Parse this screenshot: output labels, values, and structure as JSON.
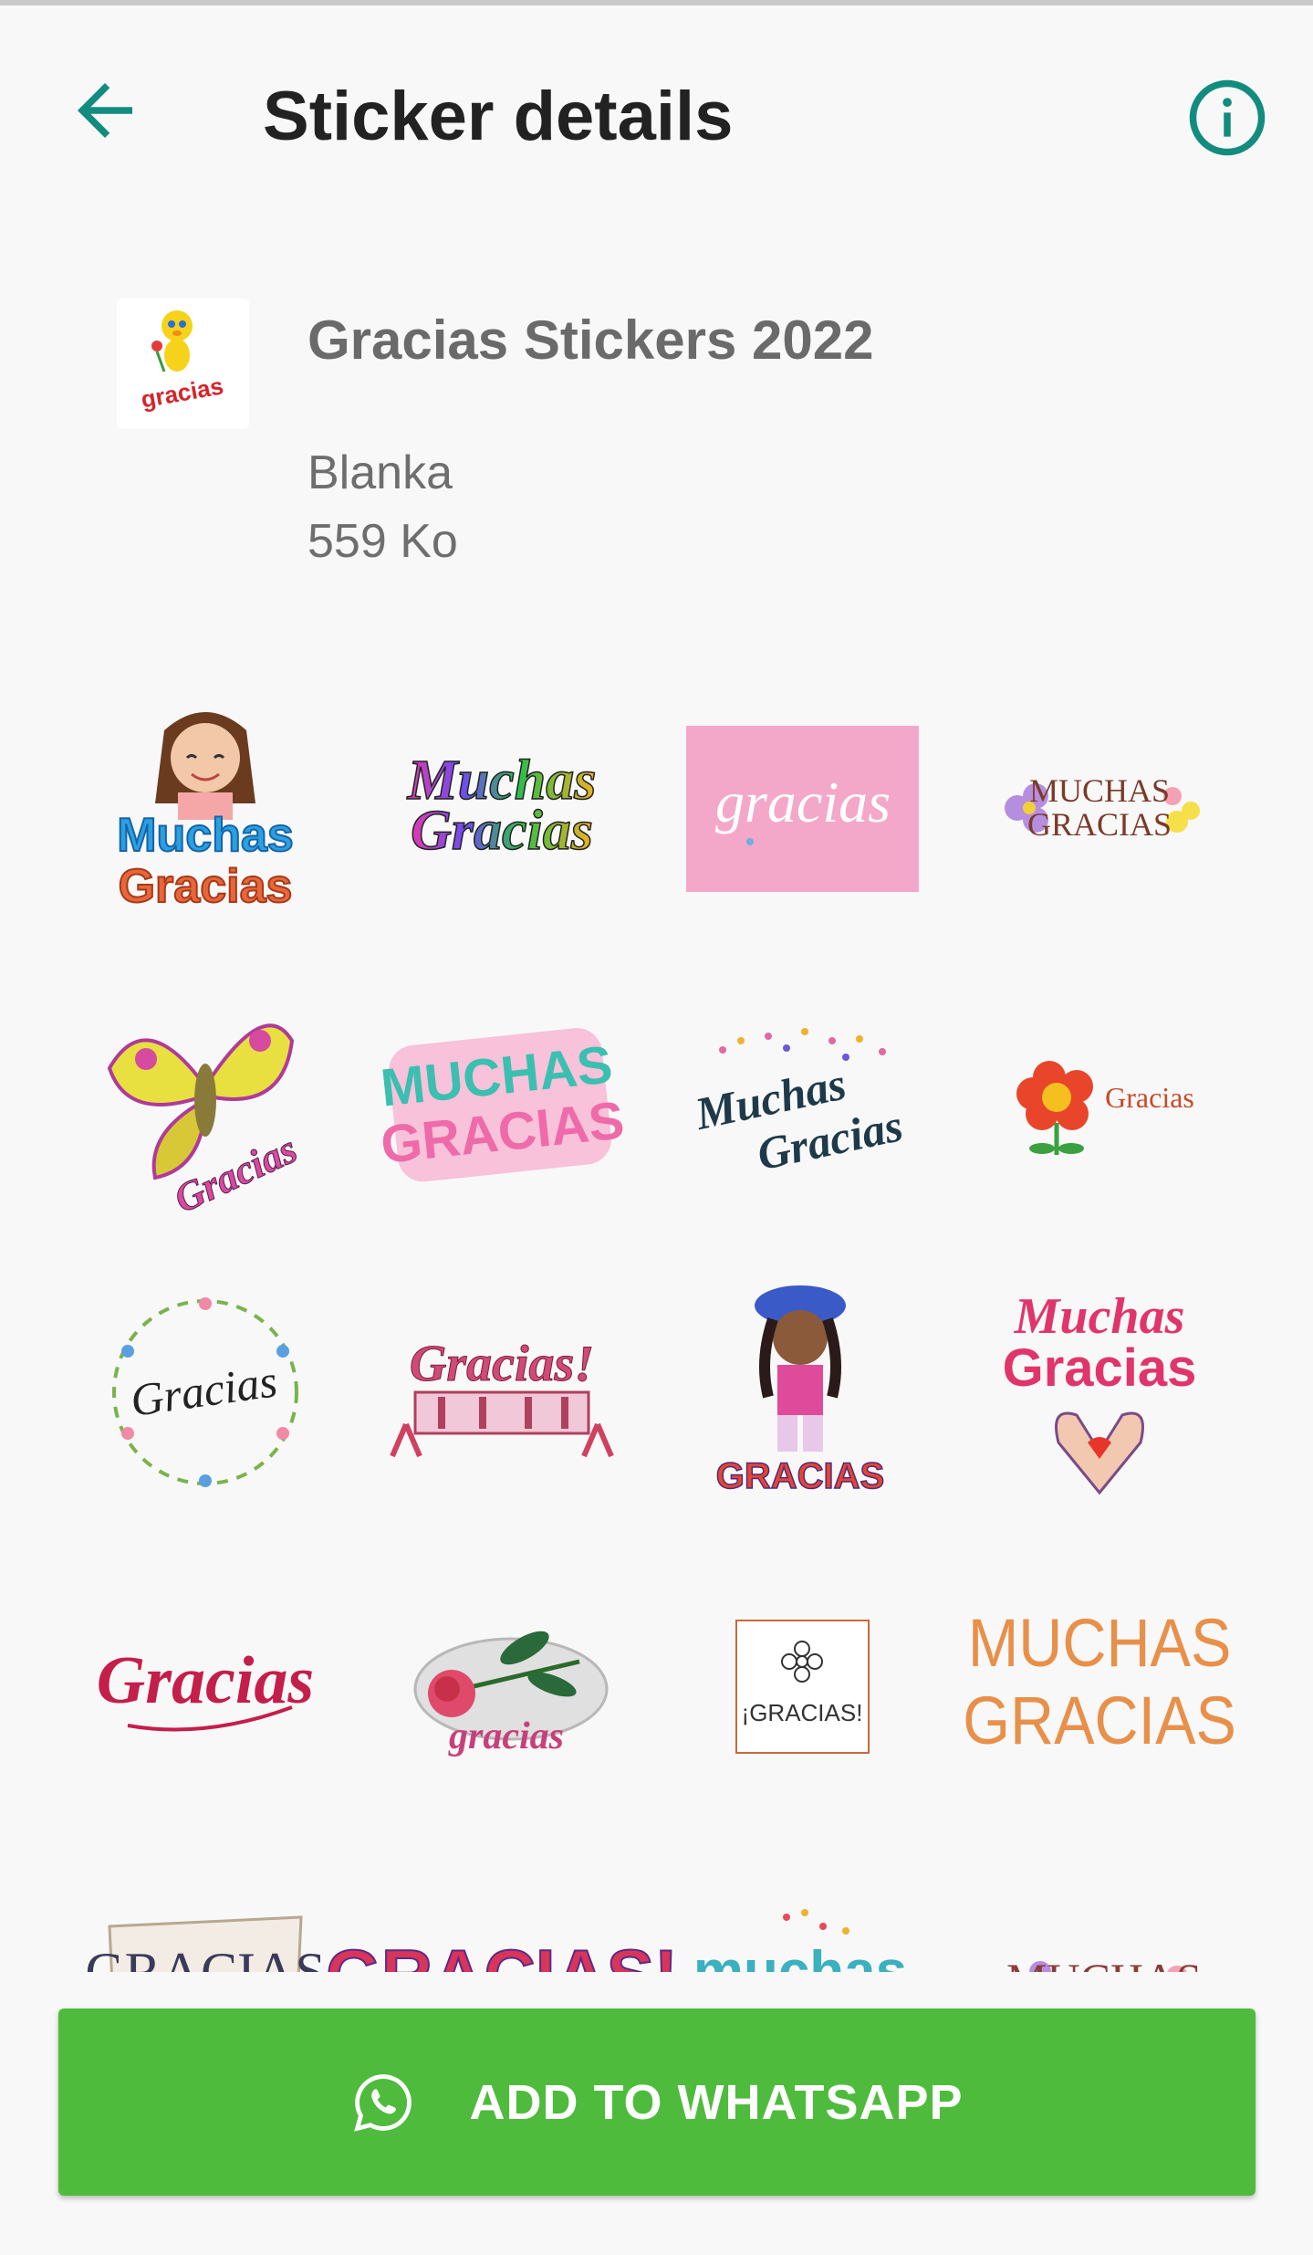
{
  "header": {
    "title": "Sticker details",
    "back_icon": "arrow-left-icon",
    "info_icon": "info-circle-icon",
    "accent": "#128c7e"
  },
  "pack": {
    "name": "Gracias Stickers 2022",
    "author": "Blanka",
    "size": "559 Ko",
    "thumb_text": "gracias"
  },
  "stickers": [
    {
      "line1": "Muchas",
      "line2": "Gracias"
    },
    {
      "line1": "Muchas",
      "line2": "Gracias"
    },
    {
      "line1": "gracias"
    },
    {
      "line1": "MUCHAS",
      "line2": "GRACIAS"
    },
    {
      "line1": "Gracias"
    },
    {
      "line1": "MUCHAS",
      "line2": "GRACIAS"
    },
    {
      "line1": "Muchas",
      "line2": "Gracias"
    },
    {
      "line1": "Gracias"
    },
    {
      "line1": "Gracias"
    },
    {
      "line1": "Gracias!"
    },
    {
      "line1": "GRACIAS"
    },
    {
      "line1": "Muchas",
      "line2": "Gracias"
    },
    {
      "line1": "Gracias"
    },
    {
      "line1": "gracias"
    },
    {
      "line1": "¡GRACIAS!"
    },
    {
      "line1": "MUCHAS",
      "line2": "GRACIAS"
    },
    {
      "line1": "GRACIAS"
    },
    {
      "line1": "GRACIAS!"
    },
    {
      "line1": "muchas"
    },
    {
      "line1": "MUCHAS"
    }
  ],
  "add_button": {
    "label": "ADD TO WHATSAPP",
    "icon": "whatsapp-icon",
    "color": "#4ebb3c"
  }
}
